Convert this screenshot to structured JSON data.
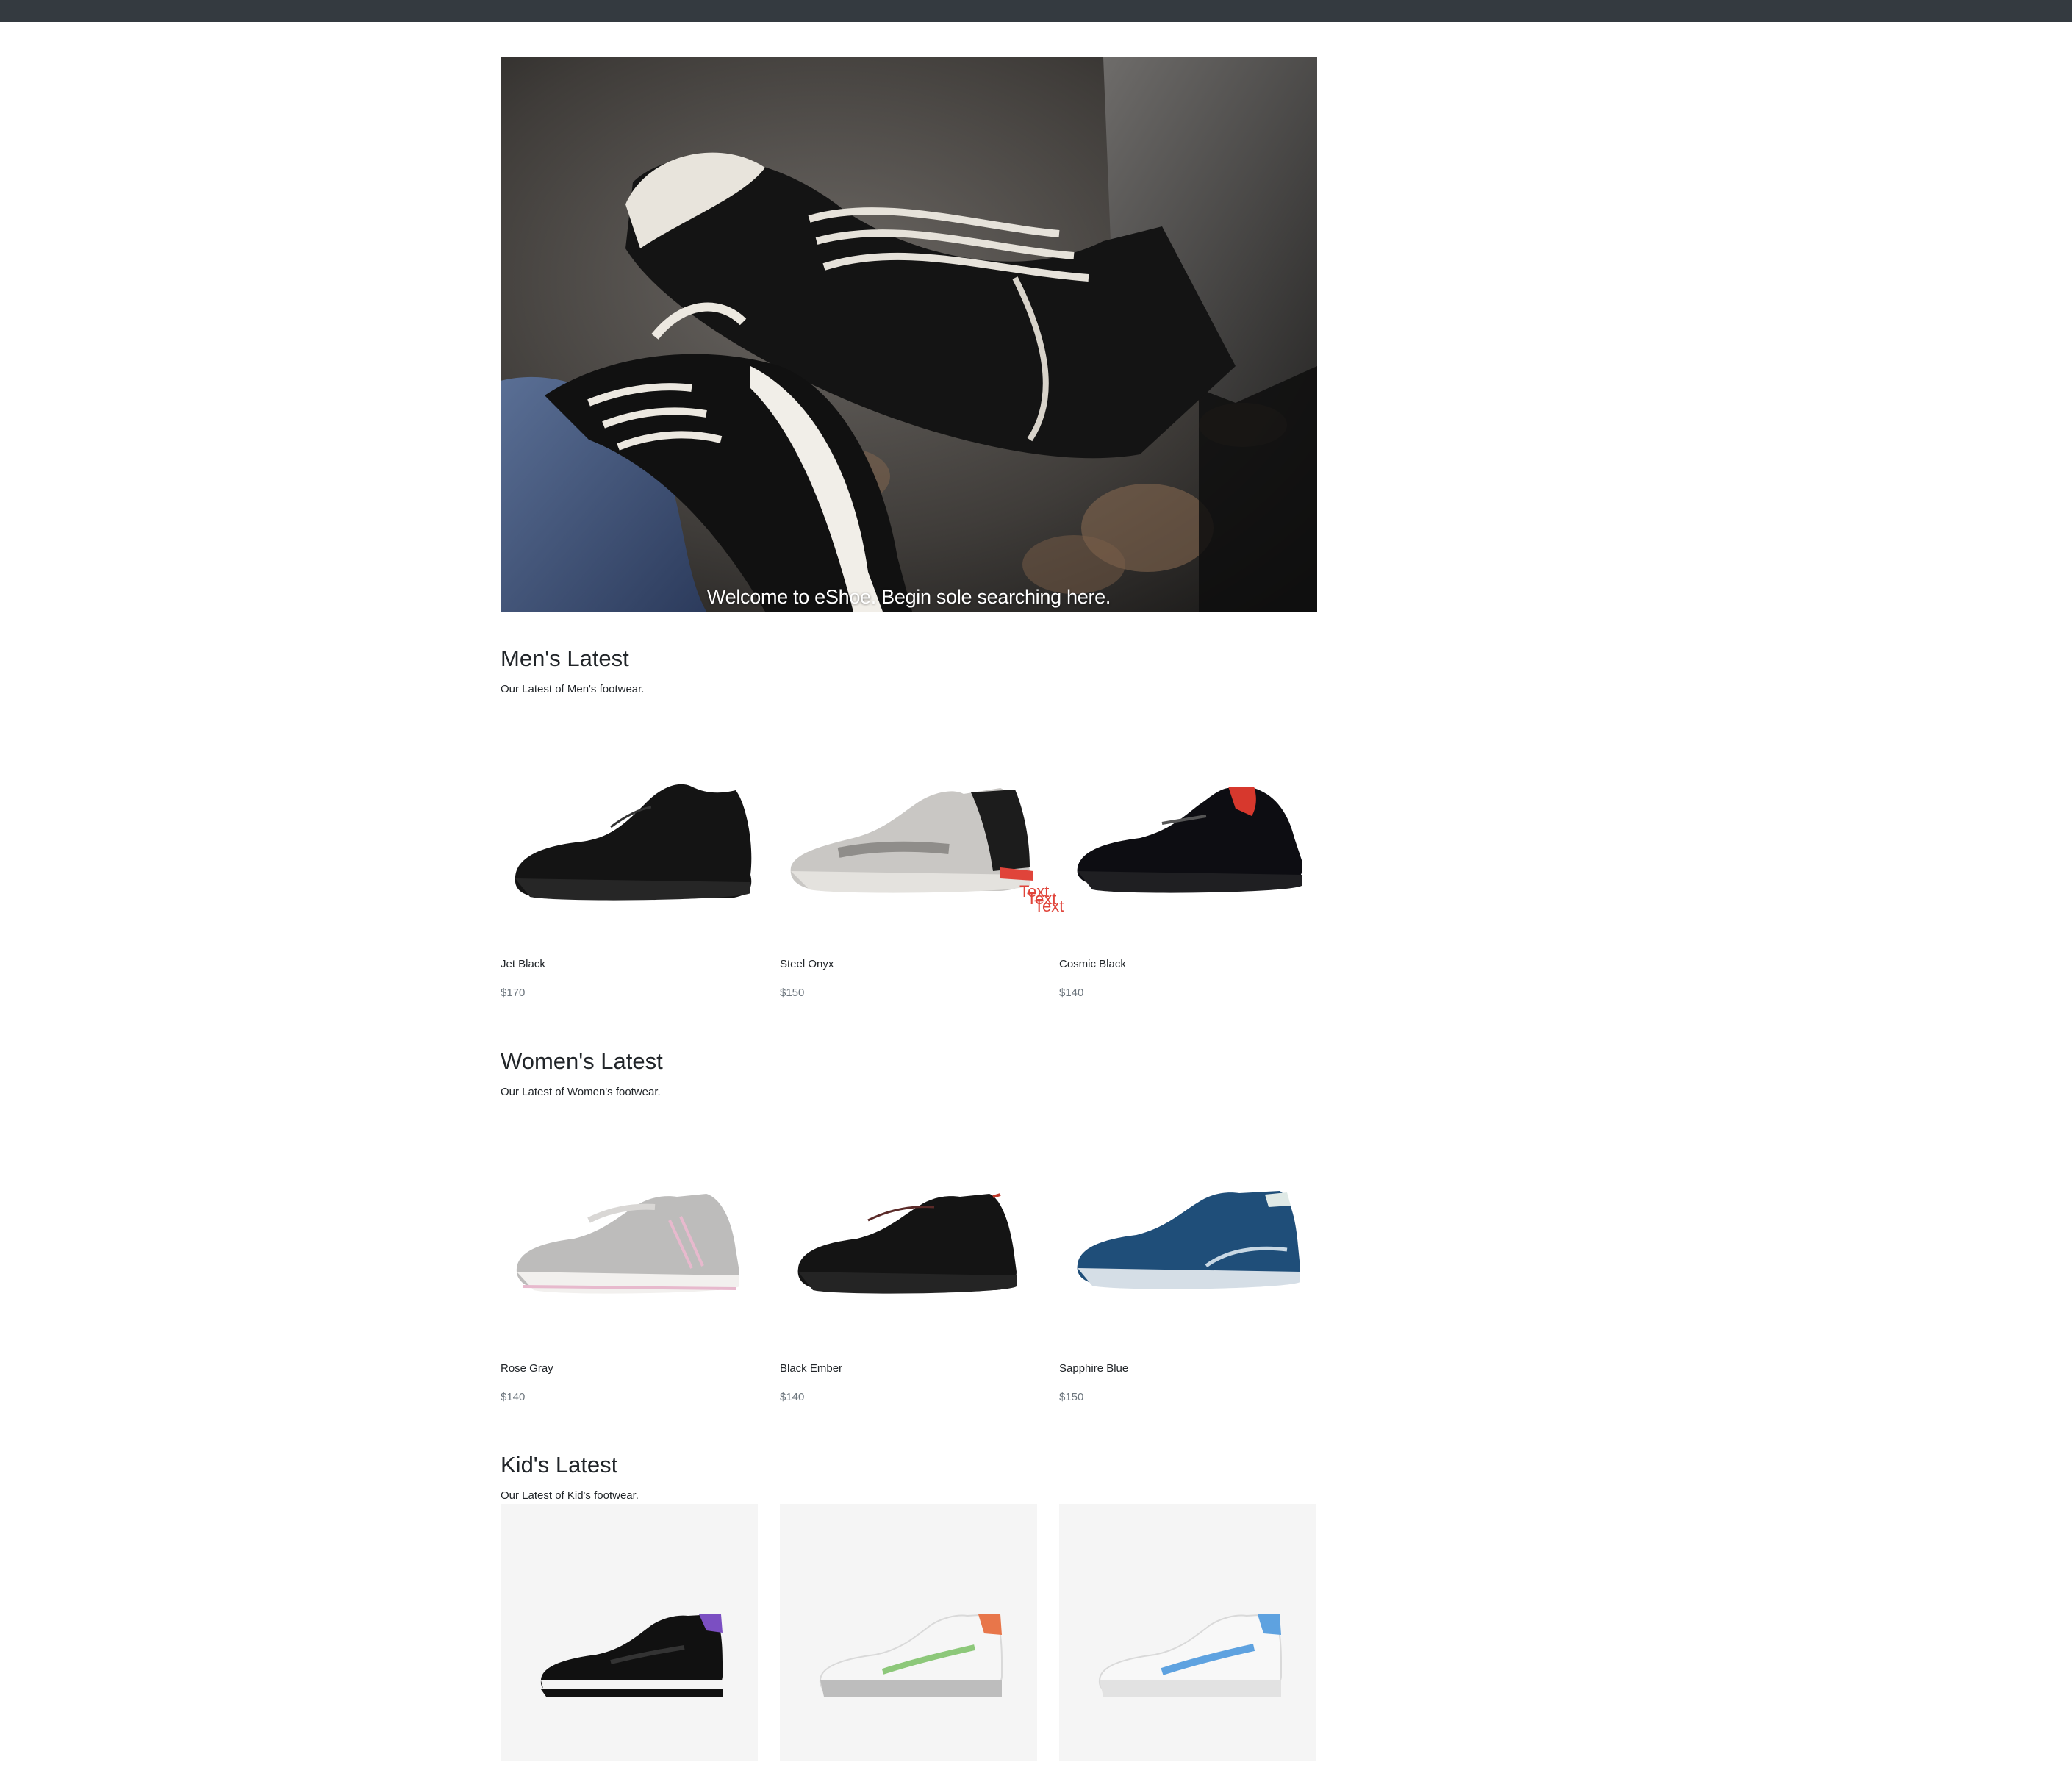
{
  "hero": {
    "caption": "Welcome to eShoe. Begin sole searching here."
  },
  "sections": {
    "men": {
      "title": "Men's Latest",
      "subtitle": "Our Latest of Men's footwear.",
      "products": [
        {
          "name": "Jet Black",
          "price": "$170"
        },
        {
          "name": "Steel Onyx",
          "price": "$150"
        },
        {
          "name": "Cosmic Black",
          "price": "$140"
        }
      ]
    },
    "women": {
      "title": "Women's Latest",
      "subtitle": "Our Latest of Women's footwear.",
      "products": [
        {
          "name": "Rose Gray",
          "price": "$140"
        },
        {
          "name": "Black Ember",
          "price": "$140"
        },
        {
          "name": "Sapphire Blue",
          "price": "$150"
        }
      ]
    },
    "kids": {
      "title": "Kid's Latest",
      "subtitle": "Our Latest of Kid's footwear."
    }
  },
  "overlay": {
    "text1": "Text",
    "text2": "Text",
    "text3": "Text"
  },
  "colors": {
    "topbar": "#343a40",
    "price": "#6c757d",
    "overlay_text": "#e0443a"
  }
}
